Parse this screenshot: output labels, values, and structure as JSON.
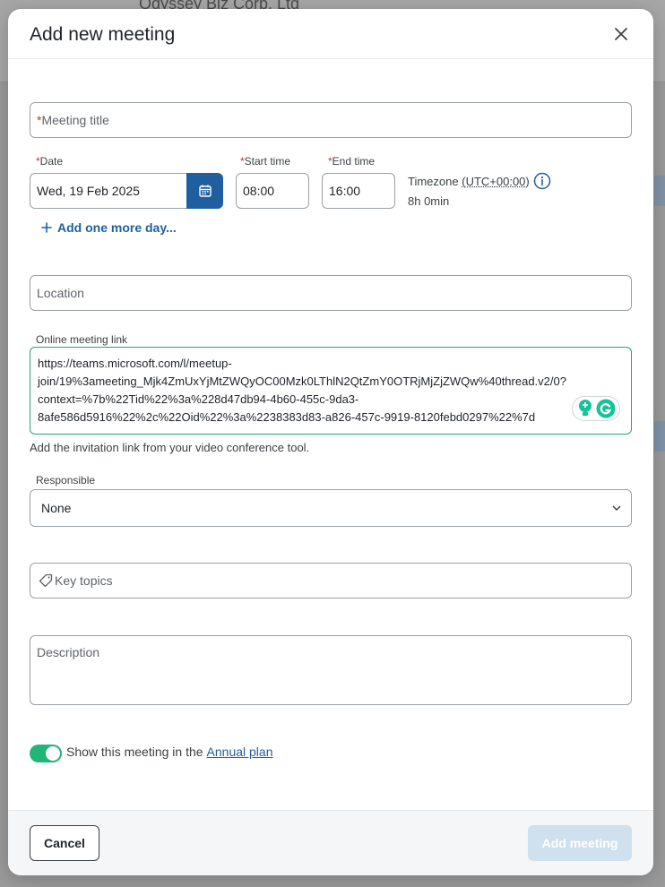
{
  "background": {
    "company": "Odyssey Biz Corp. Ltd"
  },
  "modal": {
    "title": "Add new meeting",
    "meeting_title": {
      "required_mark": "*",
      "placeholder": "Meeting title"
    },
    "date": {
      "required_mark": "*",
      "label": "Date",
      "value": "Wed, 19 Feb 2025"
    },
    "start_time": {
      "required_mark": "*",
      "label": "Start time",
      "value": "08:00"
    },
    "end_time": {
      "required_mark": "*",
      "label": "End time",
      "value": "16:00"
    },
    "timezone": {
      "label": "Timezone",
      "value": "(UTC+00:00)",
      "duration": "8h 0min"
    },
    "add_day": "Add one more day...",
    "location": {
      "placeholder": "Location"
    },
    "online_link": {
      "label": "Online meeting link",
      "lines": [
        "https://teams.microsoft.com/l/meetup-",
        "join/19%3ameeting_Mjk4ZmUxYjMtZWQyOC00Mzk0LThlN2QtZmY0OTRjMjZjZWQw%40thread.v2/0?",
        "context=%7b%22Tid%22%3a%228d47db94-4b60-455c-9da3-",
        "8afe586d5916%22%2c%22Oid%22%3a%2238383d83-a826-457c-9919-8120febd0297%22%7d"
      ],
      "hint": "Add the invitation link from your video conference tool."
    },
    "responsible": {
      "label": "Responsible",
      "value": "None"
    },
    "key_topics": {
      "placeholder": "Key topics"
    },
    "description": {
      "placeholder": "Description"
    },
    "annual_plan": {
      "text": "Show this meeting in the",
      "link": "Annual plan",
      "enabled": true
    },
    "footer": {
      "cancel": "Cancel",
      "add": "Add meeting"
    }
  },
  "colors": {
    "primary": "#1f5fa0",
    "success": "#22b57a",
    "required": "#c0392b",
    "disabled_button": "#cfe0ee"
  }
}
